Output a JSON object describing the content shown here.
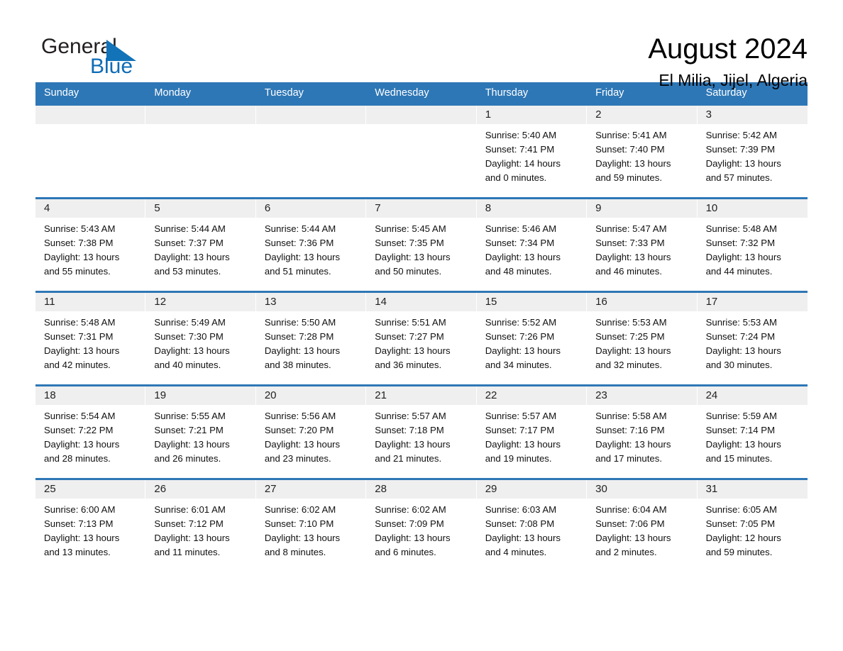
{
  "brand": {
    "word_one": "General",
    "word_two": "Blue",
    "triangle_color": "#1273b8",
    "text_color": "#231f20",
    "blue_text_color": "#0f6cb5"
  },
  "header": {
    "title": "August 2024",
    "subtitle": "El Milia, Jijel, Algeria"
  },
  "theme": {
    "header_bar": "#2e77b6",
    "row_divider": "#2e77b6",
    "daynum_band": "#efefef",
    "cell_background": "#ffffff",
    "text": "#101010"
  },
  "calendar": {
    "weekdays": [
      "Sunday",
      "Monday",
      "Tuesday",
      "Wednesday",
      "Thursday",
      "Friday",
      "Saturday"
    ],
    "weeks": [
      [
        {
          "day": "",
          "empty": true
        },
        {
          "day": "",
          "empty": true
        },
        {
          "day": "",
          "empty": true
        },
        {
          "day": "",
          "empty": true
        },
        {
          "day": "1",
          "sunrise": "Sunrise: 5:40 AM",
          "sunset": "Sunset: 7:41 PM",
          "daylight_line1": "Daylight: 14 hours",
          "daylight_line2": "and 0 minutes."
        },
        {
          "day": "2",
          "sunrise": "Sunrise: 5:41 AM",
          "sunset": "Sunset: 7:40 PM",
          "daylight_line1": "Daylight: 13 hours",
          "daylight_line2": "and 59 minutes."
        },
        {
          "day": "3",
          "sunrise": "Sunrise: 5:42 AM",
          "sunset": "Sunset: 7:39 PM",
          "daylight_line1": "Daylight: 13 hours",
          "daylight_line2": "and 57 minutes."
        }
      ],
      [
        {
          "day": "4",
          "sunrise": "Sunrise: 5:43 AM",
          "sunset": "Sunset: 7:38 PM",
          "daylight_line1": "Daylight: 13 hours",
          "daylight_line2": "and 55 minutes."
        },
        {
          "day": "5",
          "sunrise": "Sunrise: 5:44 AM",
          "sunset": "Sunset: 7:37 PM",
          "daylight_line1": "Daylight: 13 hours",
          "daylight_line2": "and 53 minutes."
        },
        {
          "day": "6",
          "sunrise": "Sunrise: 5:44 AM",
          "sunset": "Sunset: 7:36 PM",
          "daylight_line1": "Daylight: 13 hours",
          "daylight_line2": "and 51 minutes."
        },
        {
          "day": "7",
          "sunrise": "Sunrise: 5:45 AM",
          "sunset": "Sunset: 7:35 PM",
          "daylight_line1": "Daylight: 13 hours",
          "daylight_line2": "and 50 minutes."
        },
        {
          "day": "8",
          "sunrise": "Sunrise: 5:46 AM",
          "sunset": "Sunset: 7:34 PM",
          "daylight_line1": "Daylight: 13 hours",
          "daylight_line2": "and 48 minutes."
        },
        {
          "day": "9",
          "sunrise": "Sunrise: 5:47 AM",
          "sunset": "Sunset: 7:33 PM",
          "daylight_line1": "Daylight: 13 hours",
          "daylight_line2": "and 46 minutes."
        },
        {
          "day": "10",
          "sunrise": "Sunrise: 5:48 AM",
          "sunset": "Sunset: 7:32 PM",
          "daylight_line1": "Daylight: 13 hours",
          "daylight_line2": "and 44 minutes."
        }
      ],
      [
        {
          "day": "11",
          "sunrise": "Sunrise: 5:48 AM",
          "sunset": "Sunset: 7:31 PM",
          "daylight_line1": "Daylight: 13 hours",
          "daylight_line2": "and 42 minutes."
        },
        {
          "day": "12",
          "sunrise": "Sunrise: 5:49 AM",
          "sunset": "Sunset: 7:30 PM",
          "daylight_line1": "Daylight: 13 hours",
          "daylight_line2": "and 40 minutes."
        },
        {
          "day": "13",
          "sunrise": "Sunrise: 5:50 AM",
          "sunset": "Sunset: 7:28 PM",
          "daylight_line1": "Daylight: 13 hours",
          "daylight_line2": "and 38 minutes."
        },
        {
          "day": "14",
          "sunrise": "Sunrise: 5:51 AM",
          "sunset": "Sunset: 7:27 PM",
          "daylight_line1": "Daylight: 13 hours",
          "daylight_line2": "and 36 minutes."
        },
        {
          "day": "15",
          "sunrise": "Sunrise: 5:52 AM",
          "sunset": "Sunset: 7:26 PM",
          "daylight_line1": "Daylight: 13 hours",
          "daylight_line2": "and 34 minutes."
        },
        {
          "day": "16",
          "sunrise": "Sunrise: 5:53 AM",
          "sunset": "Sunset: 7:25 PM",
          "daylight_line1": "Daylight: 13 hours",
          "daylight_line2": "and 32 minutes."
        },
        {
          "day": "17",
          "sunrise": "Sunrise: 5:53 AM",
          "sunset": "Sunset: 7:24 PM",
          "daylight_line1": "Daylight: 13 hours",
          "daylight_line2": "and 30 minutes."
        }
      ],
      [
        {
          "day": "18",
          "sunrise": "Sunrise: 5:54 AM",
          "sunset": "Sunset: 7:22 PM",
          "daylight_line1": "Daylight: 13 hours",
          "daylight_line2": "and 28 minutes."
        },
        {
          "day": "19",
          "sunrise": "Sunrise: 5:55 AM",
          "sunset": "Sunset: 7:21 PM",
          "daylight_line1": "Daylight: 13 hours",
          "daylight_line2": "and 26 minutes."
        },
        {
          "day": "20",
          "sunrise": "Sunrise: 5:56 AM",
          "sunset": "Sunset: 7:20 PM",
          "daylight_line1": "Daylight: 13 hours",
          "daylight_line2": "and 23 minutes."
        },
        {
          "day": "21",
          "sunrise": "Sunrise: 5:57 AM",
          "sunset": "Sunset: 7:18 PM",
          "daylight_line1": "Daylight: 13 hours",
          "daylight_line2": "and 21 minutes."
        },
        {
          "day": "22",
          "sunrise": "Sunrise: 5:57 AM",
          "sunset": "Sunset: 7:17 PM",
          "daylight_line1": "Daylight: 13 hours",
          "daylight_line2": "and 19 minutes."
        },
        {
          "day": "23",
          "sunrise": "Sunrise: 5:58 AM",
          "sunset": "Sunset: 7:16 PM",
          "daylight_line1": "Daylight: 13 hours",
          "daylight_line2": "and 17 minutes."
        },
        {
          "day": "24",
          "sunrise": "Sunrise: 5:59 AM",
          "sunset": "Sunset: 7:14 PM",
          "daylight_line1": "Daylight: 13 hours",
          "daylight_line2": "and 15 minutes."
        }
      ],
      [
        {
          "day": "25",
          "sunrise": "Sunrise: 6:00 AM",
          "sunset": "Sunset: 7:13 PM",
          "daylight_line1": "Daylight: 13 hours",
          "daylight_line2": "and 13 minutes."
        },
        {
          "day": "26",
          "sunrise": "Sunrise: 6:01 AM",
          "sunset": "Sunset: 7:12 PM",
          "daylight_line1": "Daylight: 13 hours",
          "daylight_line2": "and 11 minutes."
        },
        {
          "day": "27",
          "sunrise": "Sunrise: 6:02 AM",
          "sunset": "Sunset: 7:10 PM",
          "daylight_line1": "Daylight: 13 hours",
          "daylight_line2": "and 8 minutes."
        },
        {
          "day": "28",
          "sunrise": "Sunrise: 6:02 AM",
          "sunset": "Sunset: 7:09 PM",
          "daylight_line1": "Daylight: 13 hours",
          "daylight_line2": "and 6 minutes."
        },
        {
          "day": "29",
          "sunrise": "Sunrise: 6:03 AM",
          "sunset": "Sunset: 7:08 PM",
          "daylight_line1": "Daylight: 13 hours",
          "daylight_line2": "and 4 minutes."
        },
        {
          "day": "30",
          "sunrise": "Sunrise: 6:04 AM",
          "sunset": "Sunset: 7:06 PM",
          "daylight_line1": "Daylight: 13 hours",
          "daylight_line2": "and 2 minutes."
        },
        {
          "day": "31",
          "sunrise": "Sunrise: 6:05 AM",
          "sunset": "Sunset: 7:05 PM",
          "daylight_line1": "Daylight: 12 hours",
          "daylight_line2": "and 59 minutes."
        }
      ]
    ]
  }
}
